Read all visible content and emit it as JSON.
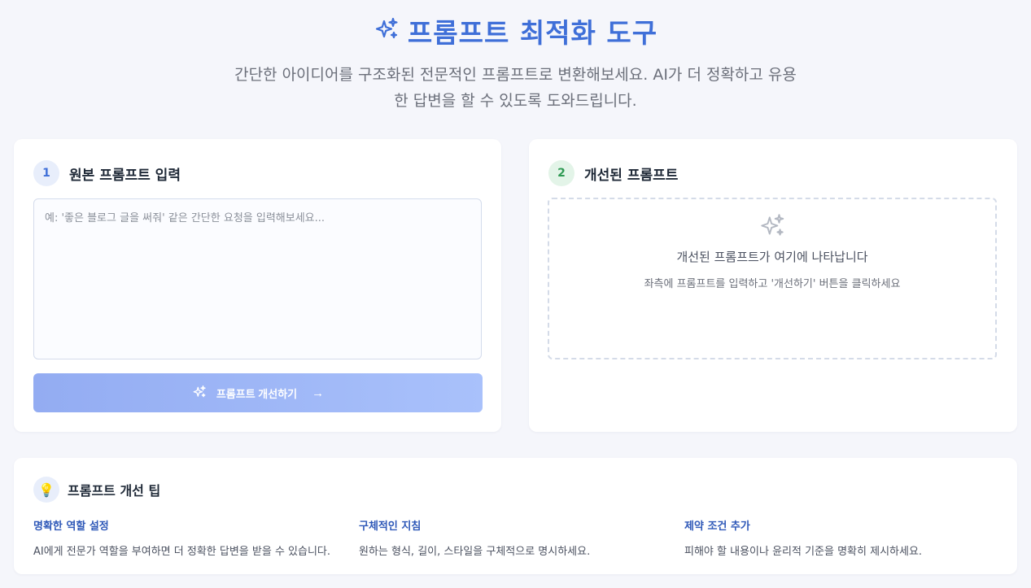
{
  "header": {
    "title": "프롬프트 최적화 도구",
    "title_icon": "sparkles-icon",
    "subtitle_line1": "간단한 아이디어를 구조화된 전문적인 프롬프트로 변환해보세요. AI가 더 정확하고 유용",
    "subtitle_line2": "한 답변을 할 수 있도록 도와드립니다."
  },
  "input_card": {
    "step": "1",
    "title": "원본 프롬프트 입력",
    "input_value": "",
    "placeholder": "예: '좋은 블로그 글을 써줘' 같은 간단한 요청을 입력해보세요...",
    "button_label": "프롬프트 개선하기",
    "button_icon": "sparkles-icon",
    "button_arrow": "→"
  },
  "output_card": {
    "step": "2",
    "title": "개선된 프롬프트",
    "empty_icon": "sparkles-icon",
    "empty_title": "개선된 프롬프트가 여기에 나타납니다",
    "empty_hint": "좌측에 프롬프트를 입력하고 '개선하기' 버튼을 클릭하세요"
  },
  "tips": {
    "icon": "lightbulb-icon",
    "bulb_glyph": "💡",
    "title": "프롬프트 개선 팁",
    "items": [
      {
        "title": "명확한 역할 설정",
        "desc": "AI에게 전문가 역할을 부여하면 더 정확한 답변을 받을 수 있습니다."
      },
      {
        "title": "구체적인 지침",
        "desc": "원하는 형식, 길이, 스타일을 구체적으로 명시하세요."
      },
      {
        "title": "제약 조건 추가",
        "desc": "피해야 할 내용이나 윤리적 기준을 명확히 제시하세요."
      }
    ]
  },
  "colors": {
    "accent": "#3f6fd8",
    "button_gradient_start": "#93acf2",
    "button_gradient_end": "#a9c1fb",
    "step_green": "#2f9a53",
    "tip_title": "#2e58b8",
    "background": "#f5f6fb"
  }
}
